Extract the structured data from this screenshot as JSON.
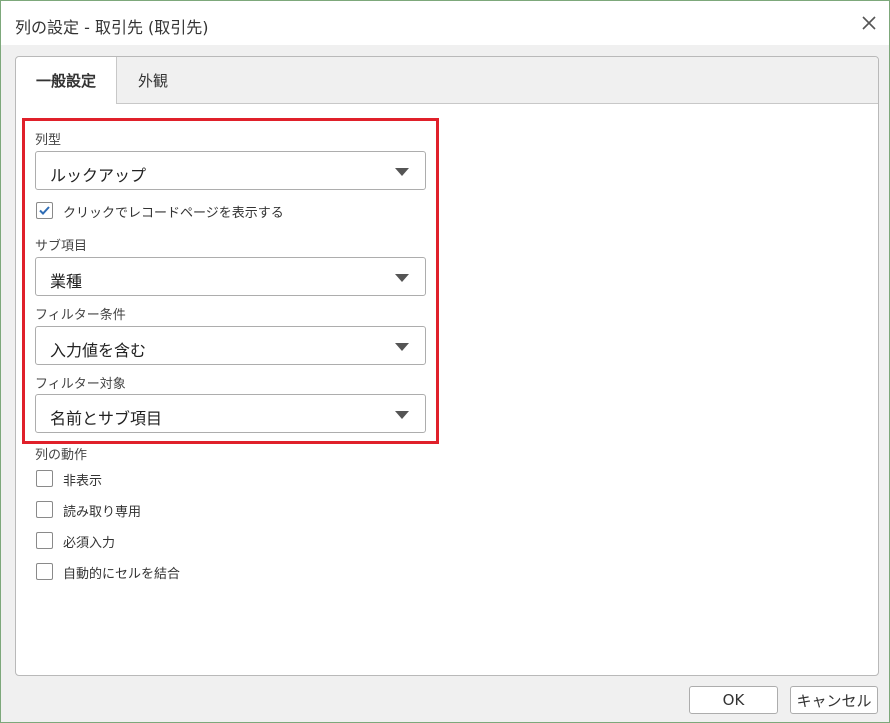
{
  "window": {
    "title": "列の設定 - 取引先 (取引先)"
  },
  "tabs": [
    {
      "label": "一般設定",
      "active": true
    },
    {
      "label": "外観",
      "active": false
    }
  ],
  "general": {
    "column_type": {
      "label": "列型",
      "value": "ルックアップ"
    },
    "open_record_checkbox": {
      "label": "クリックでレコードページを表示する",
      "checked": true
    },
    "sub_field": {
      "label": "サブ項目",
      "value": "業種"
    },
    "filter_condition": {
      "label": "フィルター条件",
      "value": "入力値を含む"
    },
    "filter_target": {
      "label": "フィルター対象",
      "value": "名前とサブ項目"
    },
    "column_behavior": {
      "label": "列の動作",
      "options": [
        {
          "label": "非表示",
          "checked": false
        },
        {
          "label": "読み取り専用",
          "checked": false
        },
        {
          "label": "必須入力",
          "checked": false
        },
        {
          "label": "自動的にセルを結合",
          "checked": false
        }
      ]
    }
  },
  "footer": {
    "ok_label": "OK",
    "cancel_label": "キャンセル"
  },
  "colors": {
    "highlight": "#e0202a",
    "check": "#2f6db5",
    "window_border": "#7da87b"
  }
}
